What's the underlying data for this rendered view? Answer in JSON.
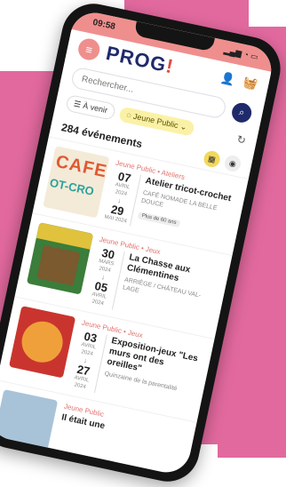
{
  "status": {
    "time": "09:58"
  },
  "header": {
    "logo_main": "PROG",
    "logo_mark": "!"
  },
  "search": {
    "placeholder": "Rechercher..."
  },
  "filters": {
    "list_label": "À venir",
    "category_label": "Jeune Public"
  },
  "results": {
    "count": "284 événements"
  },
  "events": [
    {
      "category": "Jeune Public • Ateliers",
      "thumb_line1": "CAFE",
      "thumb_line2": "OT-CRO",
      "start_day": "07",
      "start_month": "AVRIL 2024",
      "end_day": "29",
      "end_month": "MAI 2024",
      "title": "Atelier tricot-crochet",
      "place": "CAFÉ NOMADE LA BELLE DOUCE",
      "tag": "Plus de 60 ans"
    },
    {
      "category": "Jeune Public • Jeux",
      "start_day": "30",
      "start_month": "MARS 2024",
      "end_day": "05",
      "end_month": "AVRIL 2024",
      "title": "La Chasse aux Clémentines",
      "place": "ARRIÈGE / CHÂTEAU VAL-LAGE"
    },
    {
      "category": "Jeune Public • Jeux",
      "start_day": "03",
      "start_month": "AVRIL 2024",
      "end_day": "27",
      "end_month": "AVRIL 2024",
      "title": "Exposition-jeux \"Les murs ont des oreilles\"",
      "place": "Quinzaine de la parentalité"
    },
    {
      "category": "Jeune Public",
      "title": "Il était une"
    }
  ]
}
